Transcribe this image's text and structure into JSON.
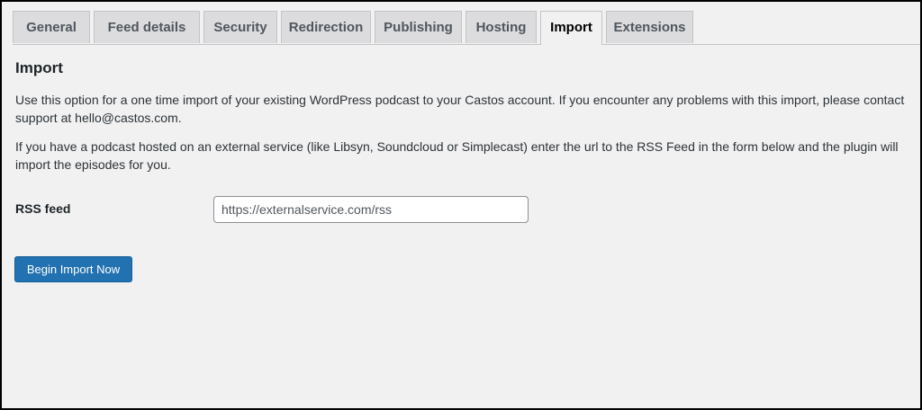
{
  "tabs": [
    {
      "label": "General",
      "active": false
    },
    {
      "label": "Feed details",
      "active": false
    },
    {
      "label": "Security",
      "active": false
    },
    {
      "label": "Redirection",
      "active": false
    },
    {
      "label": "Publishing",
      "active": false
    },
    {
      "label": "Hosting",
      "active": false
    },
    {
      "label": "Import",
      "active": true
    },
    {
      "label": "Extensions",
      "active": false
    }
  ],
  "section": {
    "title": "Import",
    "description_1": "Use this option for a one time import of your existing WordPress podcast to your Castos account. If you encounter any problems with this import, please contact support at hello@castos.com.",
    "description_2": "If you have a podcast hosted on an external service (like Libsyn, Soundcloud or Simplecast) enter the url to the RSS Feed in the form below and the plugin will import the episodes for you."
  },
  "form": {
    "rss_label": "RSS feed",
    "rss_value": "",
    "rss_placeholder": "https://externalservice.com/rss",
    "button_label": "Begin Import Now"
  },
  "colors": {
    "primary_button": "#2271b1",
    "page_background": "#f1f1f1",
    "tab_inactive": "#dcdcde"
  }
}
